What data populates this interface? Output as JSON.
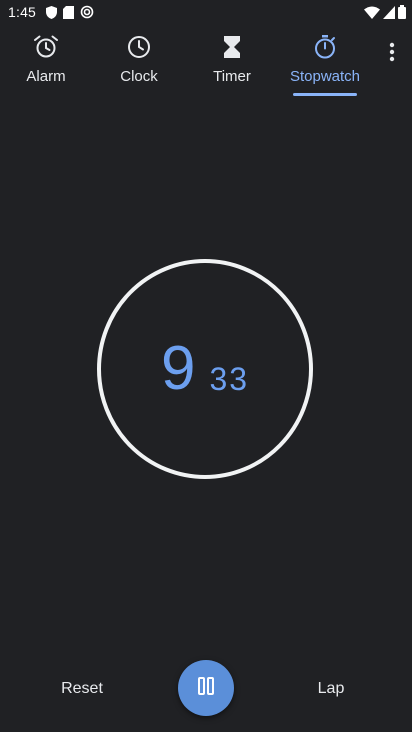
{
  "status_bar": {
    "time": "1:45",
    "left_icons": [
      "shield-icon",
      "sd-card-icon",
      "sync-icon"
    ],
    "right_icons": [
      "wifi-icon",
      "signal-icon",
      "battery-icon"
    ]
  },
  "tabs": [
    {
      "label": "Alarm",
      "icon": "alarm-clock-icon",
      "active": false
    },
    {
      "label": "Clock",
      "icon": "clock-icon",
      "active": false
    },
    {
      "label": "Timer",
      "icon": "hourglass-icon",
      "active": false
    },
    {
      "label": "Stopwatch",
      "icon": "stopwatch-icon",
      "active": true
    }
  ],
  "stopwatch": {
    "seconds": "9",
    "hundredths": "33"
  },
  "controls": {
    "reset_label": "Reset",
    "lap_label": "Lap",
    "pause_icon": "pause-icon"
  },
  "colors": {
    "background": "#202124",
    "accent": "#8ab4f8",
    "time_text": "#6c9fef",
    "fab": "#5b8fd9"
  }
}
